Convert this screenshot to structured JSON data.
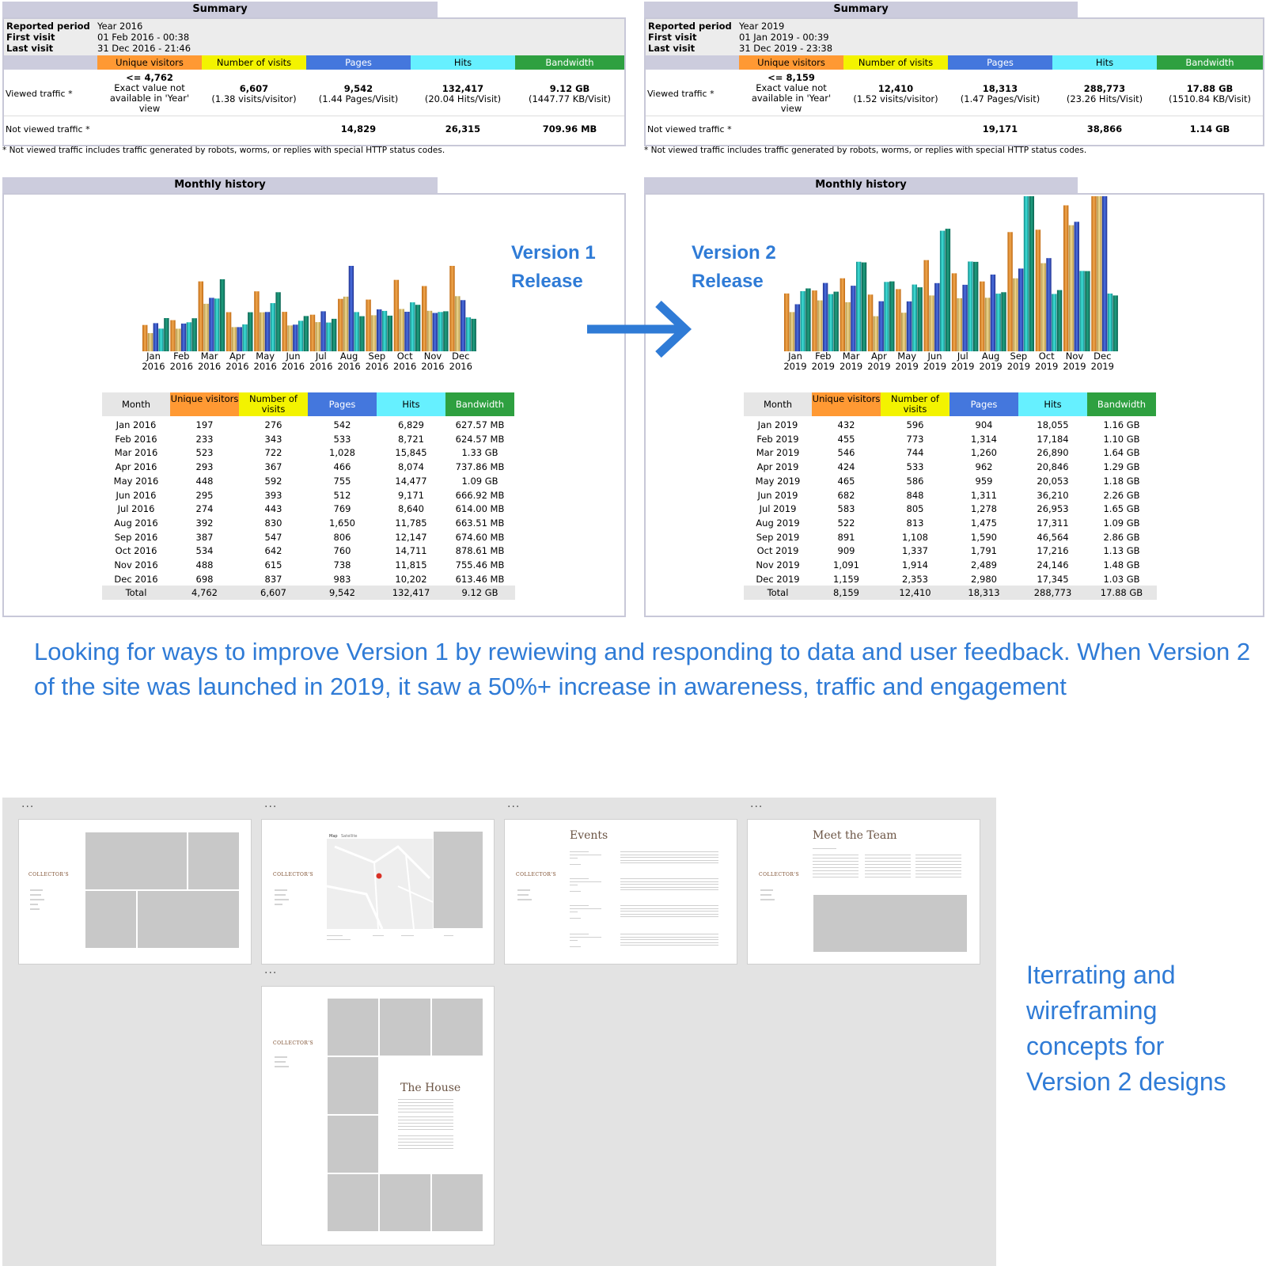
{
  "arrow_color": "#2f7bd6",
  "colors": {
    "unique": "#ff9933",
    "visits": "#f3f300",
    "pages": "#4477dd",
    "hits": "#66f0ff",
    "bandwidth": "#2ea040",
    "header_bg": "#ccccdd"
  },
  "summary_labels": {
    "title": "Summary",
    "reported": "Reported period",
    "first": "First visit",
    "last": "Last visit",
    "viewed": "Viewed traffic *",
    "not_viewed": "Not viewed traffic *",
    "col_unique": "Unique visitors",
    "col_visits": "Number of visits",
    "col_pages": "Pages",
    "col_hits": "Hits",
    "col_bandwidth": "Bandwidth",
    "footnote": "* Not viewed traffic includes traffic generated by robots, worms, or replies with special HTTP status codes.",
    "monthly_title": "Monthly history"
  },
  "v1": {
    "reported": "Year 2016",
    "first": "01 Feb 2016 - 00:38",
    "last": "31 Dec 2016 - 21:46",
    "unique_main": "<= 4,762",
    "unique_sub": "Exact value not available in 'Year' view",
    "visits_main": "6,607",
    "visits_sub": "(1.38 visits/visitor)",
    "pages_main": "9,542",
    "pages_sub": "(1.44 Pages/Visit)",
    "hits_main": "132,417",
    "hits_sub": "(20.04 Hits/Visit)",
    "bw_main": "9.12 GB",
    "bw_sub": "(1447.77 KB/Visit)",
    "nv_pages": "14,829",
    "nv_hits": "26,315",
    "nv_bw": "709.96 MB"
  },
  "v2": {
    "reported": "Year 2019",
    "first": "01 Jan 2019 - 00:39",
    "last": "31 Dec 2019 - 23:38",
    "unique_main": "<= 8,159",
    "unique_sub": "Exact value not available in 'Year' view",
    "visits_main": "12,410",
    "visits_sub": "(1.52 visits/visitor)",
    "pages_main": "18,313",
    "pages_sub": "(1.47 Pages/Visit)",
    "hits_main": "288,773",
    "hits_sub": "(23.26 Hits/Visit)",
    "bw_main": "17.88 GB",
    "bw_sub": "(1510.84 KB/Visit)",
    "nv_pages": "19,171",
    "nv_hits": "38,866",
    "nv_bw": "1.14 GB"
  },
  "table_headers": {
    "month": "Month",
    "unique": "Unique visitors",
    "visits": "Number of visits",
    "pages": "Pages",
    "hits": "Hits",
    "bandwidth": "Bandwidth"
  },
  "chart_data": [
    {
      "type": "bar",
      "categories": [
        "Jan 2016",
        "Feb 2016",
        "Mar 2016",
        "Apr 2016",
        "May 2016",
        "Jun 2016",
        "Jul 2016",
        "Aug 2016",
        "Sep 2016",
        "Oct 2016",
        "Nov 2016",
        "Dec 2016"
      ],
      "series": [
        {
          "name": "Unique visitors",
          "values": [
            197,
            233,
            523,
            293,
            448,
            295,
            274,
            392,
            387,
            534,
            488,
            698
          ]
        },
        {
          "name": "Number of visits",
          "values": [
            276,
            343,
            722,
            367,
            592,
            393,
            443,
            830,
            547,
            642,
            615,
            837
          ]
        },
        {
          "name": "Pages",
          "values": [
            542,
            533,
            1028,
            466,
            755,
            512,
            769,
            1650,
            806,
            760,
            738,
            983
          ]
        },
        {
          "name": "Hits",
          "values": [
            6829,
            8721,
            15845,
            8074,
            14477,
            9171,
            8640,
            11785,
            12147,
            14711,
            11815,
            10202
          ]
        },
        {
          "name": "Bandwidth",
          "values": [
            "627.57 MB",
            "624.57 MB",
            "1.33 GB",
            "737.86 MB",
            "1.09 GB",
            "666.92 MB",
            "614.00 MB",
            "663.51 MB",
            "674.60 MB",
            "878.61 MB",
            "755.46 MB",
            "613.46 MB"
          ]
        }
      ],
      "total": [
        "Total",
        "4,762",
        "6,607",
        "9,542",
        "132,417",
        "9.12 GB"
      ]
    },
    {
      "type": "bar",
      "categories": [
        "Jan 2019",
        "Feb 2019",
        "Mar 2019",
        "Apr 2019",
        "May 2019",
        "Jun 2019",
        "Jul 2019",
        "Aug 2019",
        "Sep 2019",
        "Oct 2019",
        "Nov 2019",
        "Dec 2019"
      ],
      "series": [
        {
          "name": "Unique visitors",
          "values": [
            432,
            455,
            546,
            424,
            465,
            682,
            583,
            522,
            891,
            909,
            1091,
            1159
          ]
        },
        {
          "name": "Number of visits",
          "values": [
            596,
            773,
            744,
            533,
            586,
            848,
            805,
            813,
            1108,
            1337,
            1914,
            2353
          ]
        },
        {
          "name": "Pages",
          "values": [
            904,
            1314,
            1260,
            962,
            959,
            1311,
            1278,
            1475,
            1590,
            1791,
            2489,
            2980
          ]
        },
        {
          "name": "Hits",
          "values": [
            18055,
            17184,
            26890,
            20846,
            20053,
            36210,
            26953,
            17311,
            46564,
            17216,
            24146,
            17345
          ]
        },
        {
          "name": "Bandwidth",
          "values": [
            "1.16 GB",
            "1.10 GB",
            "1.64 GB",
            "1.29 GB",
            "1.18 GB",
            "2.26 GB",
            "1.65 GB",
            "1.09 GB",
            "2.86 GB",
            "1.13 GB",
            "1.48 GB",
            "1.03 GB"
          ]
        }
      ],
      "total": [
        "Total",
        "8,159",
        "12,410",
        "18,313",
        "288,773",
        "17.88 GB"
      ]
    }
  ],
  "release": {
    "v1_line1": "Version 1",
    "v1_line2": "Release",
    "v2_line1": "Version 2",
    "v2_line2": "Release"
  },
  "caption": "Looking for ways to improve Version 1 by rewiewing and responding to data and user feedback. When Version 2 of the site was launched in 2019, it saw a 50%+ increase in awareness, traffic and engagement",
  "side_caption": "Iterrating and wireframing concepts for Version 2 designs",
  "wireframes": {
    "dots": "...",
    "logo": "COLLECTOR'S",
    "events_title": "Events",
    "team_title": "Meet the Team",
    "house_title": "The House",
    "map_tab1": "Map",
    "map_tab2": "Satellite"
  }
}
